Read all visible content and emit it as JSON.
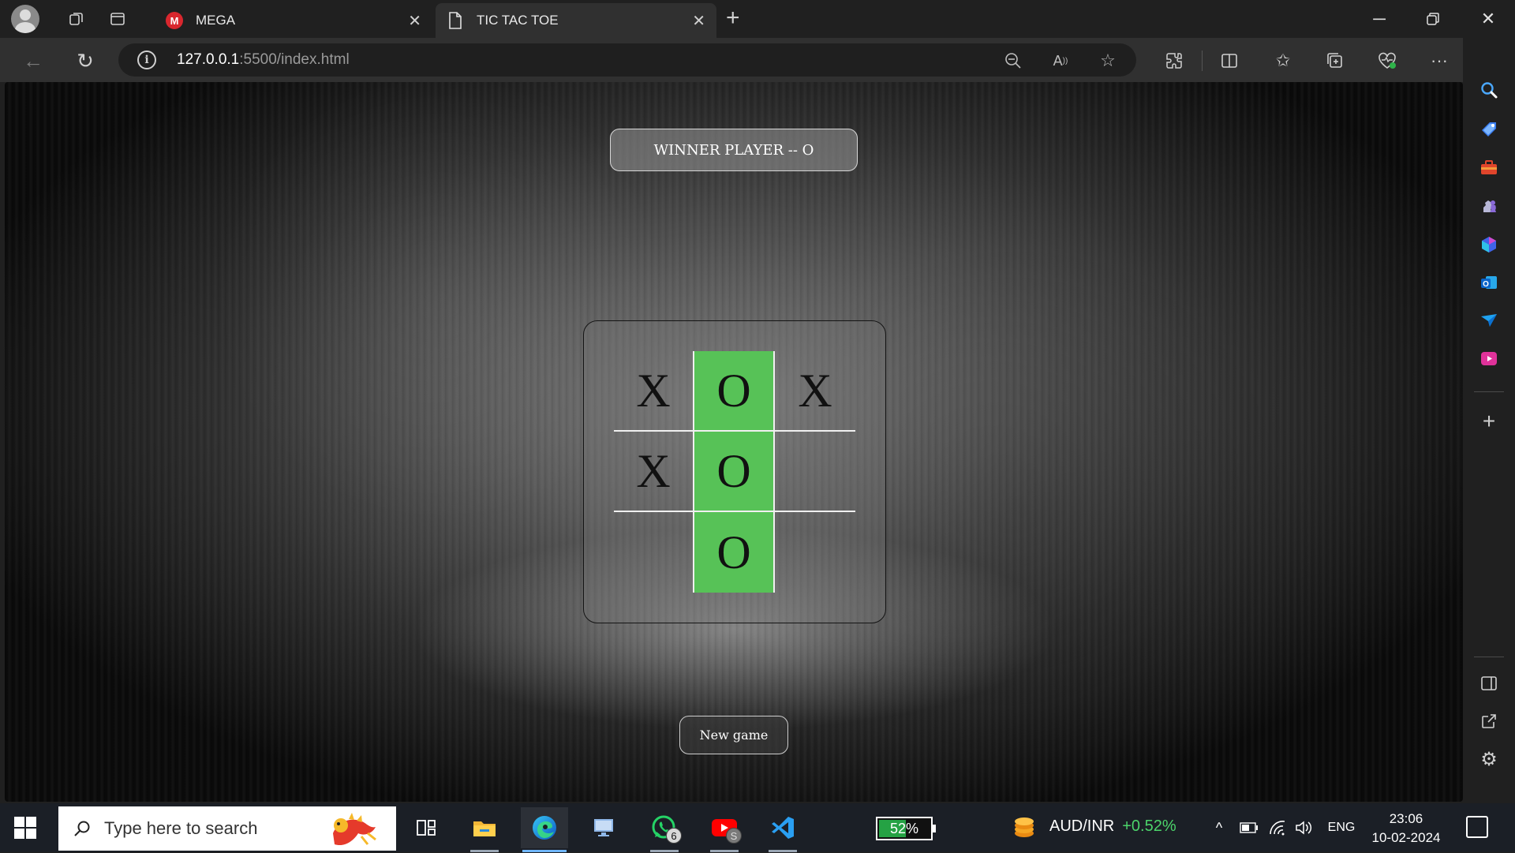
{
  "browser": {
    "tabs": [
      {
        "title": "MEGA",
        "favicon": "mega-logo",
        "active": false
      },
      {
        "title": "TIC TAC TOE",
        "favicon": "page-icon",
        "active": true
      }
    ],
    "address": {
      "host": "127.0.0.1",
      "rest": ":5500/index.html"
    }
  },
  "page": {
    "status_message": "WINNER PLAYER -- O",
    "board": [
      "X",
      "O",
      "X",
      "X",
      "O",
      "",
      "",
      "O",
      ""
    ],
    "winning_cells": [
      1,
      4,
      7
    ],
    "new_game_label": "New game",
    "colors": {
      "win_highlight": "#57c257",
      "mark": "#111111"
    }
  },
  "taskbar": {
    "search_placeholder": "Type here to search",
    "battery_widget": "52%",
    "whatsapp_badge": "6",
    "youtube_badge": "S",
    "ticker": {
      "pair": "AUD/INR",
      "change": "+0.52%"
    },
    "language": "ENG",
    "time": "23:06",
    "date": "10-02-2024"
  }
}
